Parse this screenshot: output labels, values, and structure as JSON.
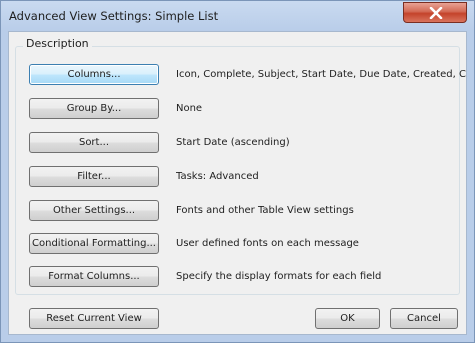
{
  "window": {
    "title": "Advanced View Settings: Simple List"
  },
  "description_group": {
    "label": "Description"
  },
  "rows": [
    {
      "button": "Columns...",
      "value": "Icon, Complete, Subject, Start Date, Due Date, Created, Cat..."
    },
    {
      "button": "Group By...",
      "value": "None"
    },
    {
      "button": "Sort...",
      "value": "Start Date (ascending)"
    },
    {
      "button": "Filter...",
      "value": "Tasks: Advanced"
    },
    {
      "button": "Other Settings...",
      "value": "Fonts and other Table View settings"
    },
    {
      "button": "Conditional Formatting...",
      "value": "User defined fonts on each message"
    },
    {
      "button": "Format Columns...",
      "value": "Specify the display formats for each field"
    }
  ],
  "footer": {
    "reset_label": "Reset Current View",
    "ok_label": "OK",
    "cancel_label": "Cancel"
  },
  "icons": {
    "close": "close-x-icon"
  },
  "colors": {
    "close_button": "#c4432b",
    "title_bar": "#b9cde9",
    "focus_border": "#3c7fb1"
  }
}
